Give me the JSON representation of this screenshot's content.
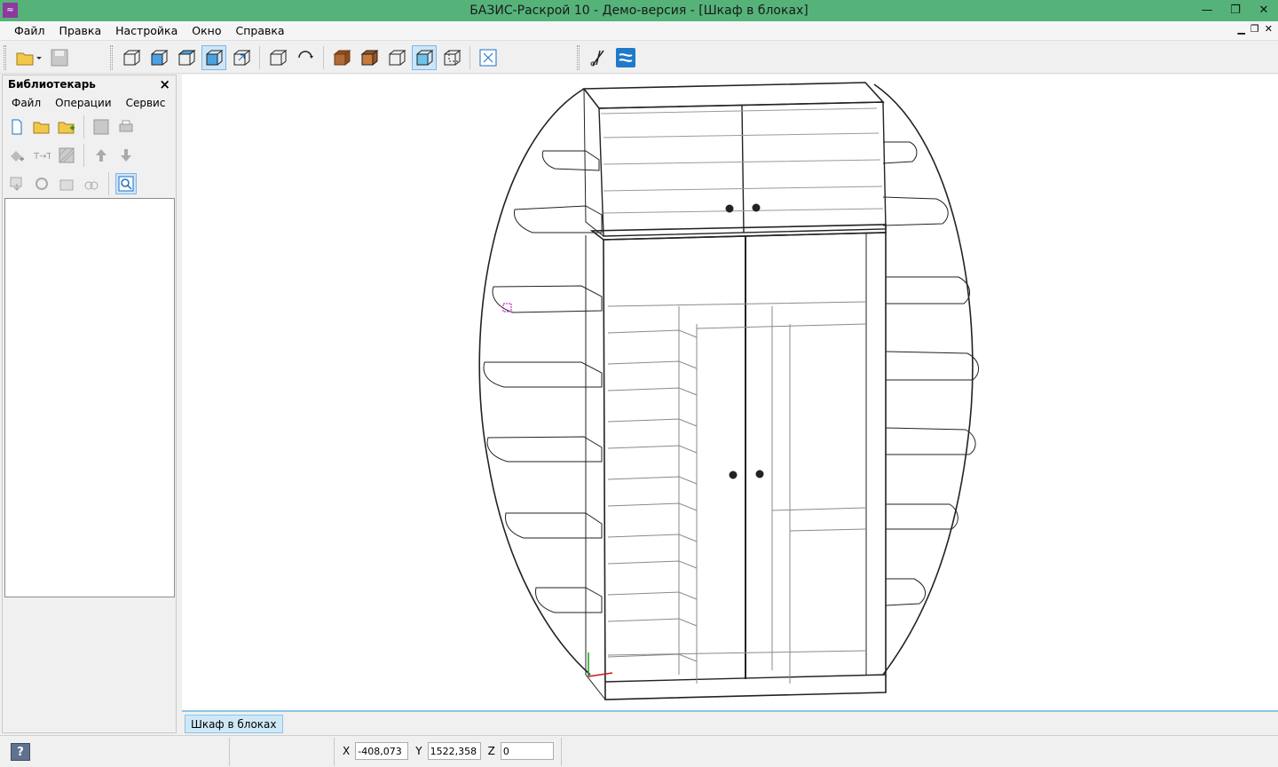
{
  "window": {
    "title": "БАЗИС-Раскрой 10 - Демо-версия - [Шкаф в блоках]"
  },
  "menu": [
    "Файл",
    "Правка",
    "Настройка",
    "Окно",
    "Справка"
  ],
  "toolbar": {
    "icons": [
      "open-folder-icon",
      "save-icon",
      "view-front-icon",
      "view-top-icon",
      "view-left-icon",
      "view-iso-icon",
      "view-custom-icon",
      "view-frame-icon",
      "rotate-icon",
      "texture-icon",
      "solid-icon",
      "wireframe-icon",
      "shaded-icon",
      "hidden-lines-icon",
      "zoom-fit-icon",
      "cut-icon",
      "bazis-icon"
    ]
  },
  "librarian": {
    "title": "Библиотекарь",
    "close": "×",
    "menu": [
      "Файл",
      "Операции",
      "Сервис"
    ]
  },
  "doc_tab": {
    "label": "Шкаф в блоках"
  },
  "status": {
    "help": "?",
    "x_label": "X",
    "x_value": "-408,073",
    "y_label": "Y",
    "y_value": "1522,358",
    "z_label": "Z",
    "z_value": "0"
  }
}
